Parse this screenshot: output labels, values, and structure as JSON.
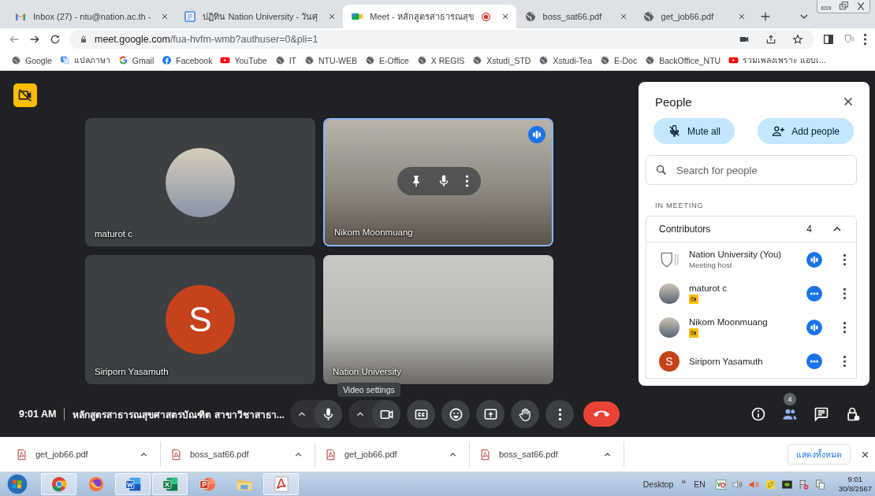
{
  "tabs": [
    {
      "title": "Inbox (27) - ntu@nation.ac.th -",
      "kind": "gmail",
      "selected": false,
      "recording": false
    },
    {
      "title": "ปฏิทิน Nation University - วันศุ",
      "kind": "calendar",
      "selected": false,
      "recording": false
    },
    {
      "title": "Meet - หลักสูตรสาธารณสุข",
      "kind": "meet",
      "selected": true,
      "recording": true
    },
    {
      "title": "boss_sat66.pdf",
      "kind": "globe",
      "selected": false,
      "recording": false
    },
    {
      "title": "get_job66.pdf",
      "kind": "globe",
      "selected": false,
      "recording": false
    }
  ],
  "address": {
    "domain": "meet.google.com",
    "path": "/fua-hvfm-wmb?authuser=0&pli=1"
  },
  "bookmarks": [
    {
      "label": "Google",
      "kind": "globe"
    },
    {
      "label": "แปลภาษา",
      "kind": "translate"
    },
    {
      "label": "Gmail",
      "kind": "google"
    },
    {
      "label": "Facebook",
      "kind": "facebook"
    },
    {
      "label": "YouTube",
      "kind": "youtube"
    },
    {
      "label": "IT",
      "kind": "globe"
    },
    {
      "label": "NTU-WEB",
      "kind": "globe"
    },
    {
      "label": "E-Office",
      "kind": "globe"
    },
    {
      "label": "X REGIS",
      "kind": "globe"
    },
    {
      "label": "Xstudi_STD",
      "kind": "globe"
    },
    {
      "label": "Xstudi-Tea",
      "kind": "globe"
    },
    {
      "label": "E-Doc",
      "kind": "globe"
    },
    {
      "label": "BackOffice_NTU",
      "kind": "globe"
    },
    {
      "label": "รวมเพลงเพราะ แอบเ...",
      "kind": "youtube"
    }
  ],
  "tiles": [
    {
      "name": "maturot c",
      "kind": "avatar",
      "speaking": false,
      "hover": false
    },
    {
      "name": "Nikom Moonmuang",
      "kind": "video",
      "speaking": true,
      "hover": true
    },
    {
      "name": "Siriporn Yasamuth",
      "kind": "letter",
      "initial": "S",
      "color": "#c5421b",
      "speaking": false,
      "hover": false
    },
    {
      "name": "Nation University",
      "kind": "video",
      "speaking": false,
      "hover": false
    }
  ],
  "people_panel": {
    "title": "People",
    "mute_all": "Mute all",
    "add_people": "Add people",
    "search_placeholder": "Search for people",
    "section": "IN MEETING",
    "group": {
      "label": "Contributors",
      "count": "4",
      "expanded": true
    },
    "participants": [
      {
        "name": "Nation University (You)",
        "subtitle": "Meeting host",
        "kind": "logo",
        "speaking": true,
        "camera_off": false
      },
      {
        "name": "maturot c",
        "kind": "photo",
        "speaking": false,
        "camera_off": true
      },
      {
        "name": "Nikom Moonmuang",
        "kind": "photo",
        "speaking": true,
        "camera_off": true
      },
      {
        "name": "Siriporn Yasamuth",
        "kind": "letter",
        "initial": "S",
        "color": "#c5421b",
        "speaking": false,
        "camera_off": false
      }
    ]
  },
  "bar": {
    "time": "9:01 AM",
    "title": "หลักสูตรสาธารณสุขศาสตรบัณฑิต สาขาวิชาสาธา...",
    "tooltip": "Video settings",
    "people_count": "4",
    "panel_open": true
  },
  "downloads": {
    "files": [
      "get_job66.pdf",
      "boss_sat66.pdf",
      "get_job66.pdf",
      "boss_sat66.pdf"
    ],
    "show_all": "แสดงทั้งหมด"
  },
  "taskbar": {
    "apps": [
      {
        "kind": "chrome",
        "running": true
      },
      {
        "kind": "firefox",
        "running": false
      },
      {
        "kind": "word",
        "running": true
      },
      {
        "kind": "excel",
        "running": true
      },
      {
        "kind": "powerpoint",
        "running": false
      },
      {
        "kind": "folder",
        "running": false
      },
      {
        "kind": "acrobat",
        "running": true
      }
    ],
    "desktop": "Desktop",
    "chevron": "»",
    "lang": "EN",
    "time": "9:01",
    "date": "30/8/2567"
  }
}
